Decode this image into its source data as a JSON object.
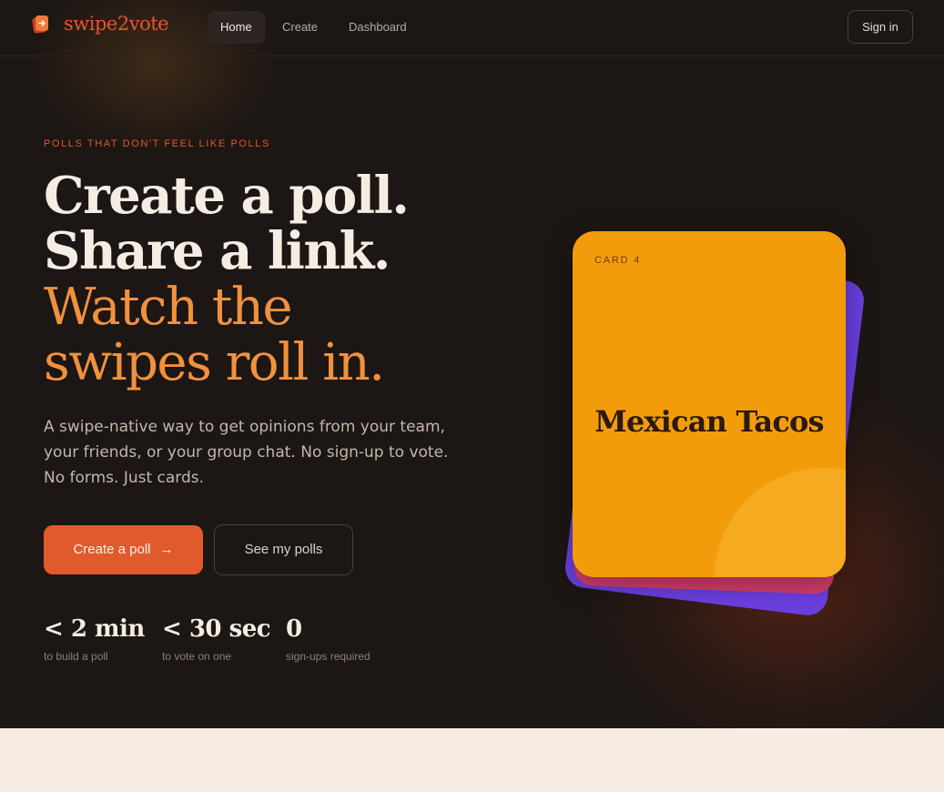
{
  "brand": {
    "name": "swipe2vote",
    "logo_icon": "swipe-card-arrow-icon",
    "color": "#e2582c"
  },
  "nav": {
    "links": [
      {
        "label": "Home",
        "active": true
      },
      {
        "label": "Create",
        "active": false
      },
      {
        "label": "Dashboard",
        "active": false
      }
    ],
    "signin_label": "Sign in"
  },
  "hero": {
    "eyebrow": "POLLS THAT DON'T FEEL LIKE POLLS",
    "headline": {
      "line1": "Create a poll.",
      "line2": "Share a link.",
      "line3": "Watch the",
      "line4": "swipes roll in."
    },
    "lede": "A swipe-native way to get opinions from your team, your friends, or your group chat. No sign-up to vote. No forms. Just cards.",
    "primary_button": {
      "label": "Create a poll",
      "icon": "arrow-right-icon"
    },
    "secondary_button": {
      "label": "See my polls"
    },
    "stats": [
      {
        "value": "< 2 min",
        "label": "to build a poll"
      },
      {
        "value": "< 30 sec",
        "label": "to vote on one"
      },
      {
        "value": "0",
        "label": "sign-ups required"
      }
    ]
  },
  "card": {
    "tag": "CARD 4",
    "title": "Mexican Tacos"
  },
  "colors": {
    "accent": "#e05a2b",
    "headline_accent": "#f0913e",
    "card_front": "#f39c0b",
    "card_pink": "#d83e6b",
    "card_purple": "#6b3fe0"
  }
}
